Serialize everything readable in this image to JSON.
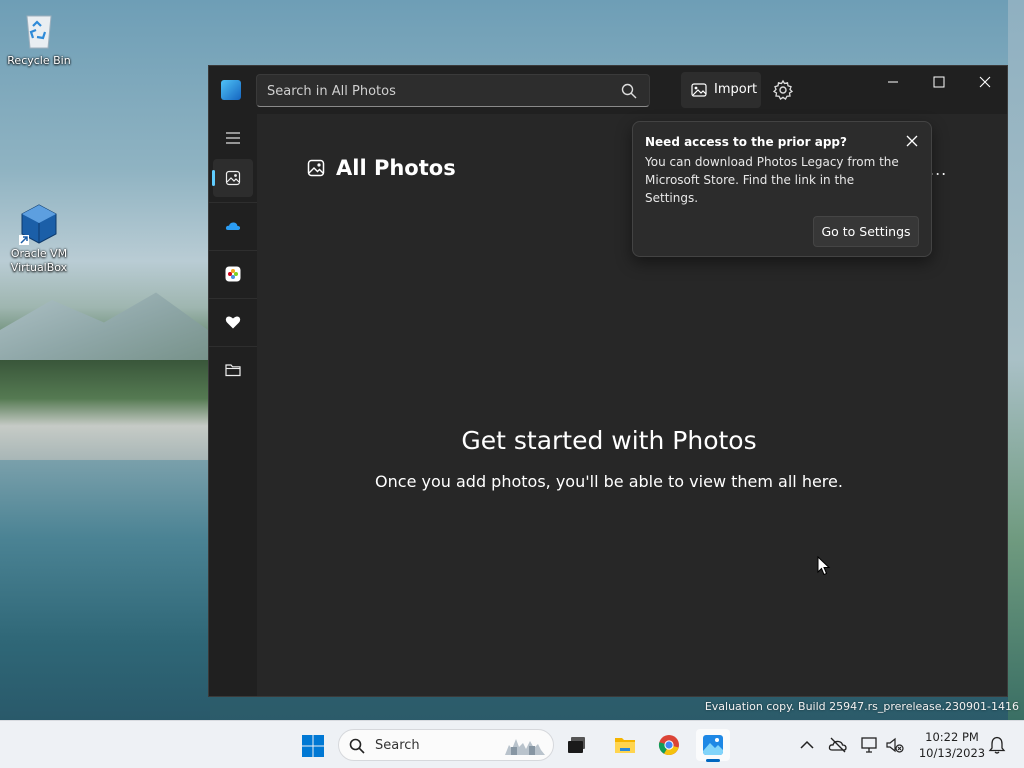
{
  "desktop": {
    "icons": [
      {
        "label": "Recycle Bin"
      },
      {
        "label": "Oracle VM VirtualBox"
      }
    ],
    "watermark": "Evaluation copy. Build 25947.rs_prerelease.230901-1416"
  },
  "app": {
    "search": {
      "placeholder": "Search in All Photos",
      "value": ""
    },
    "toolbar": {
      "import_label": "Import"
    },
    "sidebar": {
      "items": [
        {
          "icon": "menu-icon"
        },
        {
          "icon": "all-photos-icon",
          "active": true
        },
        {
          "icon": "onedrive-icon"
        },
        {
          "icon": "icloud-photos-icon"
        },
        {
          "icon": "favorites-icon"
        },
        {
          "icon": "folders-icon"
        }
      ]
    },
    "page": {
      "title": "All Photos",
      "more": "..."
    },
    "empty_state": {
      "title": "Get started with Photos",
      "subtitle": "Once you add photos, you'll be able to view them all here."
    },
    "teaching_tip": {
      "title": "Need access to the prior app?",
      "body": "You can download Photos Legacy from the Microsoft Store. Find the link in the Settings.",
      "button": "Go to Settings"
    }
  },
  "taskbar": {
    "search_label": "Search",
    "clock": {
      "time": "10:22 PM",
      "date": "10/13/2023"
    }
  },
  "colors": {
    "accent": "#60cdff",
    "window_bg": "#272727",
    "taskbar_bg": "#eef1f5"
  }
}
